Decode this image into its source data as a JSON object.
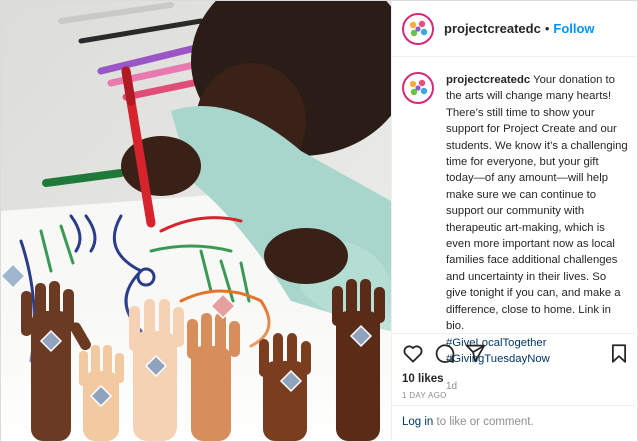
{
  "header": {
    "username": "projectcreatedc",
    "separator": "•",
    "follow_label": "Follow"
  },
  "caption": {
    "username": "projectcreatedc",
    "text": "Your donation to the arts will change many hearts! There’s still time to show your support for Project Create and our students. We know it’s a challenging time for everyone, but your gift today—of any amount—will help make sure we can continue to support our community with therapeutic art-making, which is even more important now as local families face additional challenges and uncertainty in their lives. So give tonight if you can, and make a difference, close to home. Link in bio.",
    "hashtags": [
      "#GiveLocalTogether",
      "#GivingTuesdayNow"
    ],
    "time_ago": "1d"
  },
  "actions": {
    "icons": [
      "heart-icon",
      "comment-icon",
      "share-icon",
      "bookmark-icon"
    ]
  },
  "likes": "10 likes",
  "date": "1 DAY AGO",
  "login_prompt": {
    "link": "Log in",
    "rest": " to like or comment."
  },
  "colors": {
    "follow": "#0095f6",
    "hashtag": "#00376b",
    "muted": "#8e8e8e",
    "marker_red": "#d6232c"
  }
}
